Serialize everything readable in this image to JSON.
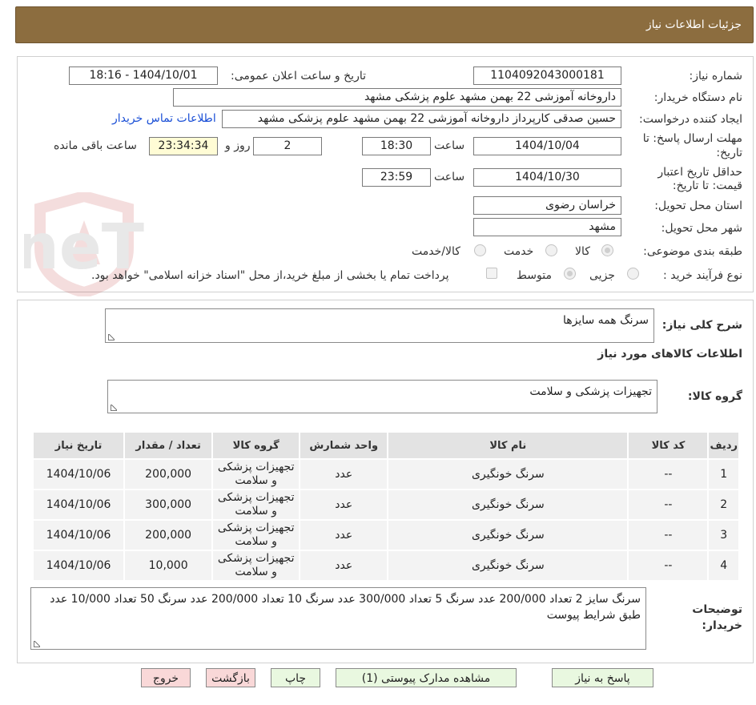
{
  "header": {
    "title": "جزئیات اطلاعات نیاز"
  },
  "form": {
    "need_number_label": "شماره نیاز:",
    "need_number": "1104092043000181",
    "announce_label": "تاریخ و ساعت اعلان عمومی:",
    "announce_value": "1404/10/01 - 18:16",
    "buyer_org_label": "نام دستگاه خریدار:",
    "buyer_org": "داروخانه آموزشی 22 بهمن مشهد   علوم پزشکی مشهد",
    "requester_label": "ایجاد کننده درخواست:",
    "requester": "حسین صدقی کارپرداز داروخانه آموزشی 22 بهمن مشهد   علوم پزشکی مشهد",
    "contact_link": "اطلاعات تماس خریدار",
    "deadline_label_1": "مهلت ارسال پاسخ: تا",
    "deadline_label_2": "تاریخ:",
    "deadline_date": "1404/10/04",
    "time_label": "ساعت",
    "deadline_time": "18:30",
    "days": "2",
    "days_label": "روز و",
    "remaining": "23:34:34",
    "remaining_label": "ساعت باقی مانده",
    "validity_label_1": "حداقل تاریخ اعتبار",
    "validity_label_2": "قیمت: تا تاریخ:",
    "validity_date": "1404/10/30",
    "validity_time": "23:59",
    "province_label": "استان محل تحویل:",
    "province": "خراسان رضوی",
    "city_label": "شهر محل تحویل:",
    "city": "مشهد",
    "category_label": "طبقه بندی موضوعی:",
    "category_options": [
      "کالا",
      "خدمت",
      "کالا/خدمت"
    ],
    "process_label": "نوع فرآیند خرید :",
    "process_options": [
      "جزیی",
      "متوسط"
    ],
    "payment_note": "پرداخت تمام یا بخشی از مبلغ خرید،از محل \"اسناد خزانه اسلامی\" خواهد بود."
  },
  "details": {
    "summary_label": "شرح کلی نیاز:",
    "summary": "سرنگ همه سایزها",
    "goods_info_title": "اطلاعات کالاهای مورد نیاز",
    "goods_group_label": "گروه کالا:",
    "goods_group": "تجهیزات پزشکی و سلامت",
    "table_headers": [
      "ردیف",
      "کد کالا",
      "نام کالا",
      "واحد شمارش",
      "گروه کالا",
      "تعداد / مقدار",
      "تاریخ نیاز"
    ],
    "rows": [
      {
        "row": "1",
        "code": "--",
        "name": "سرنگ خونگیری",
        "unit": "عدد",
        "group": "تجهیزات پزشکی و سلامت",
        "qty": "200,000",
        "date": "1404/10/06"
      },
      {
        "row": "2",
        "code": "--",
        "name": "سرنگ خونگیری",
        "unit": "عدد",
        "group": "تجهیزات پزشکی و سلامت",
        "qty": "300,000",
        "date": "1404/10/06"
      },
      {
        "row": "3",
        "code": "--",
        "name": "سرنگ خونگیری",
        "unit": "عدد",
        "group": "تجهیزات پزشکی و سلامت",
        "qty": "200,000",
        "date": "1404/10/06"
      },
      {
        "row": "4",
        "code": "--",
        "name": "سرنگ خونگیری",
        "unit": "عدد",
        "group": "تجهیزات پزشکی و سلامت",
        "qty": "10,000",
        "date": "1404/10/06"
      }
    ],
    "buyer_notes_label_1": "توضیحات",
    "buyer_notes_label_2": "خریدار:",
    "buyer_notes": "سرنگ سایز 2 تعداد 200/000 عدد سرنگ 5 تعداد 300/000 عدد سرنگ 10 تعداد 200/000 عدد سرنگ 50 تعداد 10/000 عدد طبق شرایط پیوست"
  },
  "buttons": {
    "reply": "پاسخ به نیاز",
    "attachments": "مشاهده مدارک پیوستی (1)",
    "print": "چاپ",
    "back": "بازگشت",
    "exit": "خروج"
  },
  "watermark": {
    "text": "AriaTender.neT"
  },
  "colors": {
    "header_bg": "#8c6d3f",
    "button_green": "#e9f8e0",
    "button_red": "#f9d8d8",
    "highlight_yellow": "#fffcd5"
  }
}
